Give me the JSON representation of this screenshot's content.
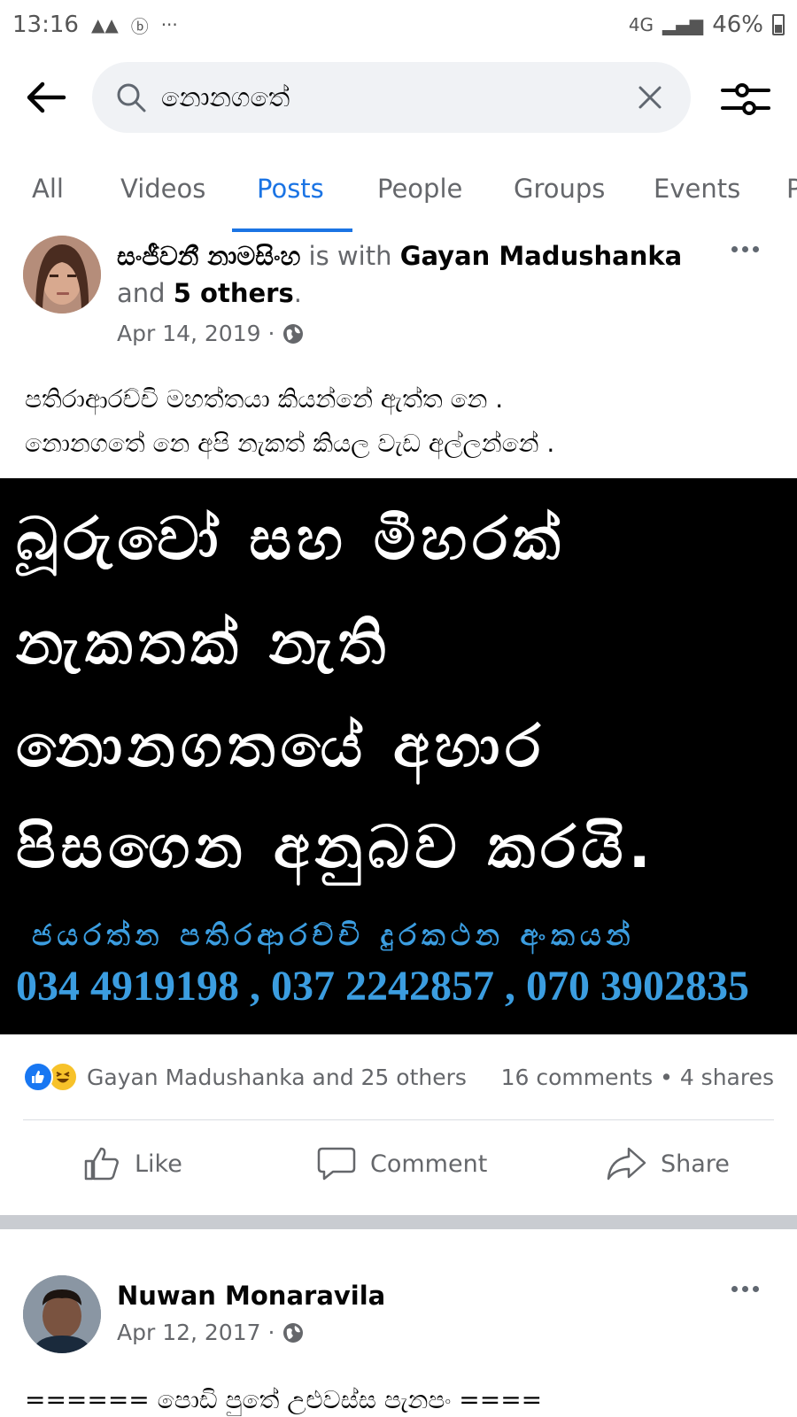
{
  "status_bar": {
    "time": "13:16",
    "notification_icons": [
      "A",
      "A",
      "ⓑ",
      "···"
    ],
    "network": "4G",
    "battery": "46%"
  },
  "search": {
    "query": "නොනගතේ"
  },
  "tabs": [
    {
      "label": "All"
    },
    {
      "label": "Videos"
    },
    {
      "label": "Posts",
      "active": true
    },
    {
      "label": "People"
    },
    {
      "label": "Groups"
    },
    {
      "label": "Events"
    },
    {
      "label": "P"
    }
  ],
  "post1": {
    "author": "සංජීවනී නාමසිංහ",
    "with_text": " is with ",
    "tagged_name": "Gayan Madushanka",
    "and_text": " and ",
    "others": "5 others",
    "period": ".",
    "date": "Apr 14, 2019 · ",
    "text_line1": "පතිරාආරච්චි මහත්තයා කියන්නේ ඇත්ත නෙ .",
    "text_line2": "නොනගතේ නෙ අපි නැකත් කියල වැඩ අල්ලන්නේ .",
    "image": {
      "line1": "බූරුවෝ සහ මීහරක්",
      "line2": "නැකතක් නැති",
      "line3": "නොනගතයේ අහාර",
      "line4": "පිසගෙන අනුබව කරයි.",
      "subtitle": "ජයරත්න පතිරආරච්චි දුරකථන අංකයන්",
      "phones": "034 4919198 , 037 2242857 , 070 3902835"
    },
    "reactions_names": "Gayan Madushanka and 25 others",
    "stats": "16 comments • 4 shares",
    "actions": {
      "like": "Like",
      "comment": "Comment",
      "share": "Share"
    }
  },
  "post2": {
    "author": "Nuwan Monaravila",
    "date": "Apr 12, 2017 · ",
    "text_line1": "====== පොඩි පුතේ උළුවස්ස පැනපං ===="
  },
  "colors": {
    "accent": "#1b74e4",
    "secondary_text": "#65676b",
    "image_bg": "#000000",
    "image_blue_text": "#3b9de0"
  }
}
